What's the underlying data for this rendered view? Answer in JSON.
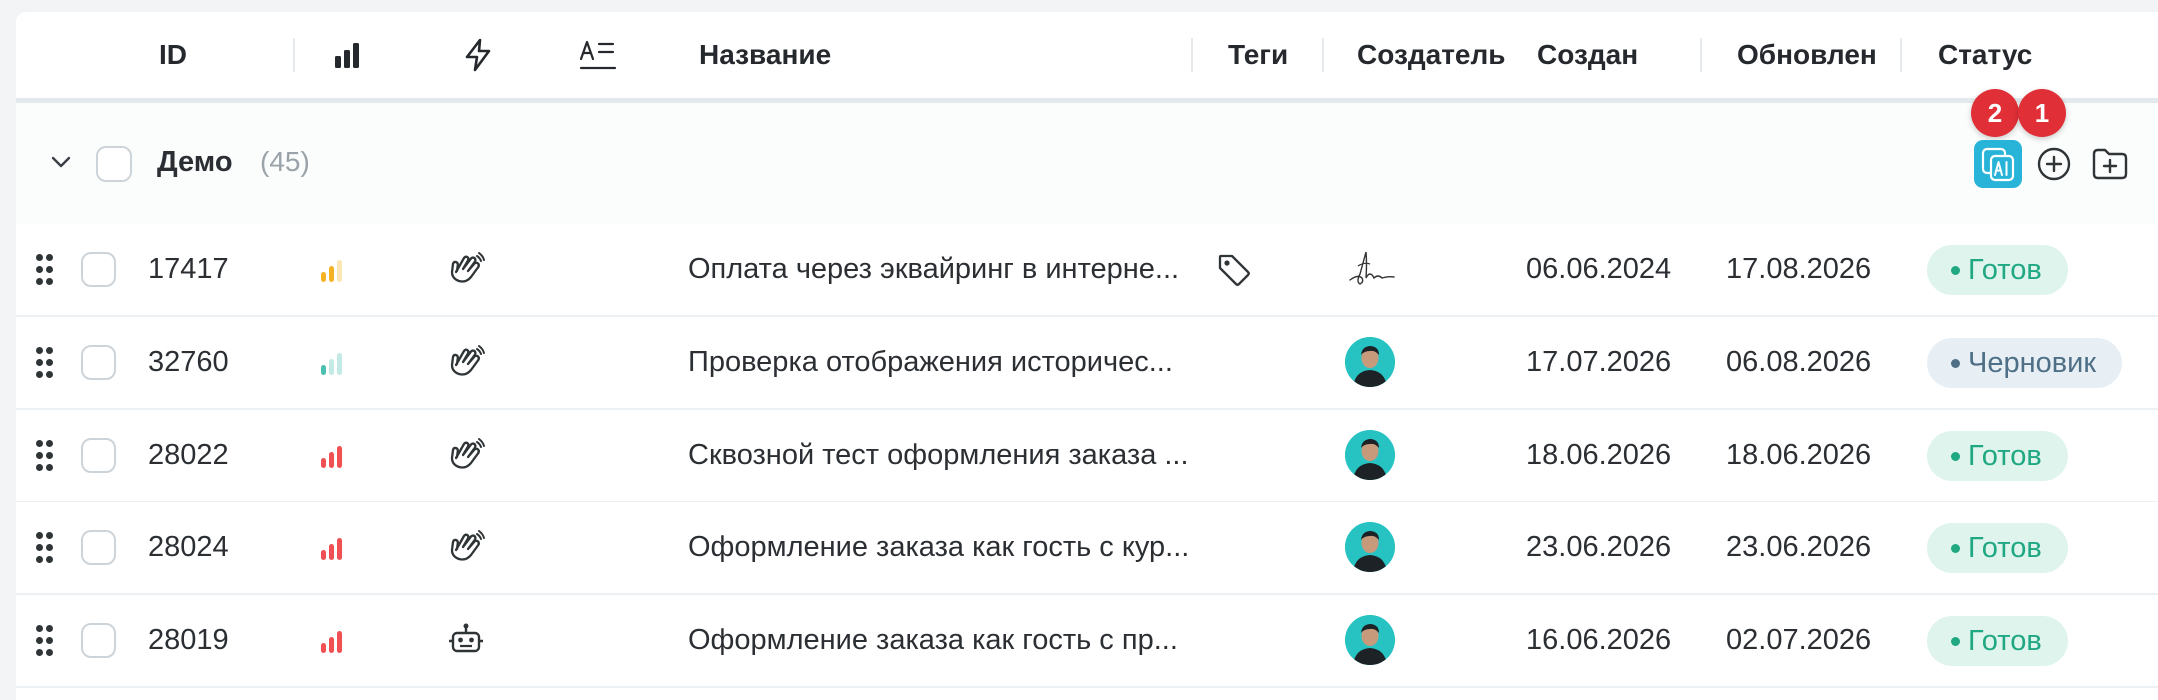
{
  "columns": {
    "id": "ID",
    "priority_icon": "bar-chart-icon",
    "type_icon": "lightning-icon",
    "sort_icon": "text-format-icon",
    "name": "Название",
    "tags": "Теги",
    "creator": "Создатель",
    "created": "Создан",
    "updated": "Обновлен",
    "status": "Статус"
  },
  "group": {
    "name": "Демо",
    "count": "(45)",
    "badges": {
      "ai": "2",
      "add": "1"
    },
    "actions": [
      "ai-generate-icon",
      "add-circle-icon",
      "add-folder-icon"
    ]
  },
  "colors": {
    "ready_bg": "#def4ed",
    "ready_fg": "#1fa882",
    "draft_bg": "#e7eff5",
    "draft_fg": "#4e6f86",
    "priority_high": "#f04f54",
    "priority_medium": "#f5b324",
    "priority_low": "#4bbfb0",
    "badge_red": "#e02f37",
    "ai_button": "#28b4d8"
  },
  "rows": [
    {
      "id": "17417",
      "priority": "medium",
      "type_icon": "hand-icon",
      "title": "Оплата через эквайринг в интерне...",
      "has_tag": true,
      "creator": "signature",
      "created": "06.06.2024",
      "updated": "17.08.2026",
      "status": "Готов",
      "status_kind": "ready"
    },
    {
      "id": "32760",
      "priority": "low",
      "type_icon": "hand-icon",
      "title": "Проверка отображения историчес...",
      "has_tag": false,
      "creator": "avatar",
      "created": "17.07.2026",
      "updated": "06.08.2026",
      "status": "Черновик",
      "status_kind": "draft"
    },
    {
      "id": "28022",
      "priority": "high",
      "type_icon": "hand-icon",
      "title": "Сквозной тест оформления заказа ...",
      "has_tag": false,
      "creator": "avatar",
      "created": "18.06.2026",
      "updated": "18.06.2026",
      "status": "Готов",
      "status_kind": "ready"
    },
    {
      "id": "28024",
      "priority": "high",
      "type_icon": "hand-icon",
      "title": "Оформление заказа как гость с кур...",
      "has_tag": false,
      "creator": "avatar",
      "created": "23.06.2026",
      "updated": "23.06.2026",
      "status": "Готов",
      "status_kind": "ready"
    },
    {
      "id": "28019",
      "priority": "high",
      "type_icon": "robot-icon",
      "title": "Оформление заказа как гость с пр...",
      "has_tag": false,
      "creator": "avatar",
      "created": "16.06.2026",
      "updated": "02.07.2026",
      "status": "Готов",
      "status_kind": "ready"
    }
  ]
}
